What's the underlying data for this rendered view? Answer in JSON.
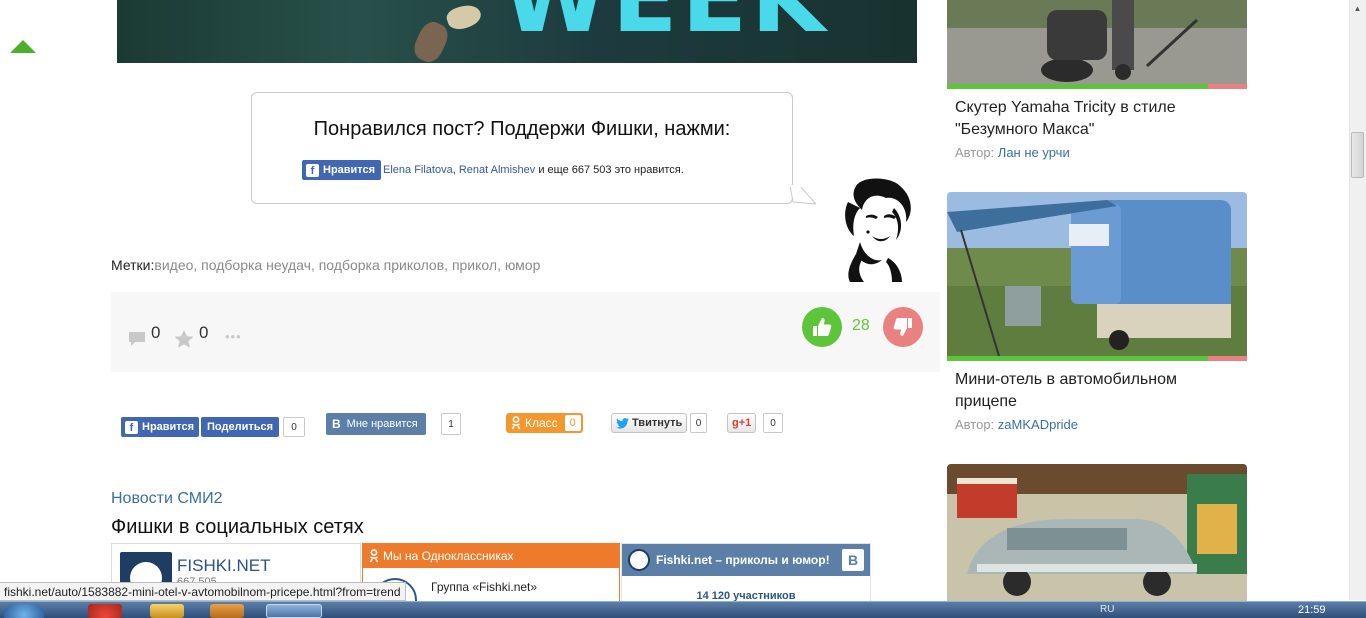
{
  "banner": {
    "word": "WEEK"
  },
  "like_box": {
    "title": "Понравился пост? Поддержи Фишки, нажми:",
    "fb_button": "Нравится",
    "fb_name1": "Elena Filatova",
    "fb_sep": ", ",
    "fb_name2": "Renat Almishev",
    "fb_suffix": " и еще 667 503 это нравится."
  },
  "tags": {
    "label": "Метки:",
    "items": [
      "видео",
      "подборка неудач",
      "подборка приколов",
      "прикол",
      "юмор"
    ]
  },
  "stats": {
    "comments": "0",
    "favorites": "0",
    "more": "•••",
    "rating": "28",
    "colors": {
      "up": "#5ec43a",
      "down": "#e8817f"
    }
  },
  "share": {
    "fb_like": "Нравится",
    "fb_share": "Поделиться",
    "fb_count": "0",
    "vk_label": "Мне нравится",
    "vk_count": "1",
    "ok_label": "Класс",
    "ok_count": "0",
    "tw_label": "Твитнуть",
    "tw_count": "0",
    "g_label": "+1",
    "g_count": "0"
  },
  "news_title": "Новости СМИ2",
  "social_title": "Фишки в социальных сетях",
  "widgets": {
    "fb_name": "FISHKI.NET",
    "fb_count": "667 505",
    "ok_header": "Мы на Одноклассниках",
    "ok_group": "Группа «Fishki.net»",
    "vk_header": "Fishki.net – приколы и юмор!",
    "vk_members": "14 120 участников"
  },
  "sidebar": {
    "cards": [
      {
        "title": "Скутер Yamaha Tricity в стиле \"Безумного Макса\"",
        "author_label": "Автор:",
        "author": "Лан не урчи",
        "rating_share": 0.87
      },
      {
        "title": "Мини-отель в автомобильном прицепе",
        "author_label": "Автор:",
        "author": "zaMKADpride",
        "rating_share": 0.87
      }
    ]
  },
  "status_url": "fishki.net/auto/1583882-mini-otel-v-avtomobilnom-pricepe.html?from=trend",
  "clock": "21:59",
  "tray": "RU"
}
